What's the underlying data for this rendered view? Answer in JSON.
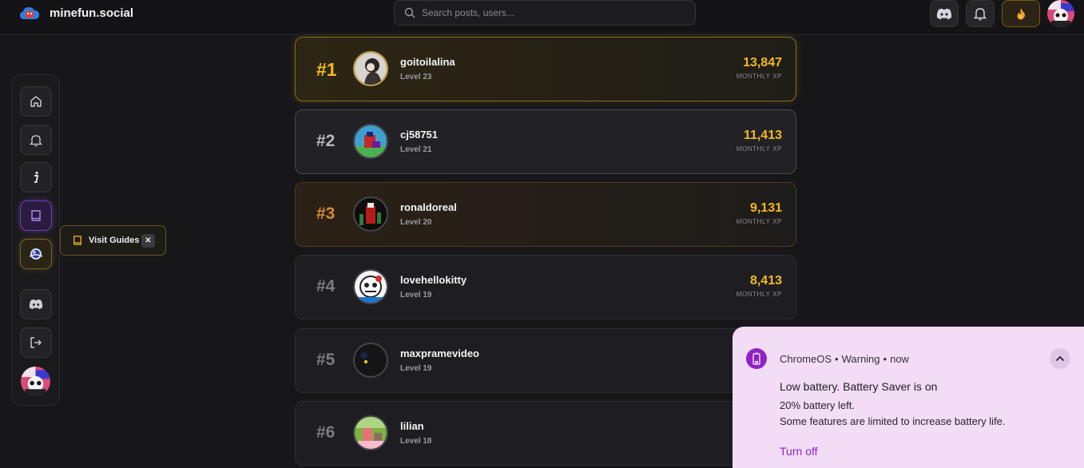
{
  "header": {
    "brand": "minefun.social",
    "search_placeholder": "Search posts, users..."
  },
  "tooltip": {
    "label": "Visit Guides",
    "close": "✕"
  },
  "leaderboard": [
    {
      "rank": "#1",
      "name": "goitoilalina",
      "level": "Level 23",
      "xp": "13,847",
      "xp_label": "MONTHLY XP"
    },
    {
      "rank": "#2",
      "name": "cj58751",
      "level": "Level 21",
      "xp": "11,413",
      "xp_label": "MONTHLY XP"
    },
    {
      "rank": "#3",
      "name": "ronaldoreal",
      "level": "Level 20",
      "xp": "9,131",
      "xp_label": "MONTHLY XP"
    },
    {
      "rank": "#4",
      "name": "lovehellokitty",
      "level": "Level 19",
      "xp": "8,413",
      "xp_label": "MONTHLY XP"
    },
    {
      "rank": "#5",
      "name": "maxpramevideo",
      "level": "Level 19",
      "xp": "",
      "xp_label": ""
    },
    {
      "rank": "#6",
      "name": "lilian",
      "level": "Level 18",
      "xp": "",
      "xp_label": ""
    }
  ],
  "notification": {
    "source": "ChromeOS",
    "severity": "Warning",
    "time": "now",
    "title": "Low battery. Battery Saver is on",
    "line1": "20% battery left.",
    "line2": "Some features are limited to increase battery life.",
    "action": "Turn off"
  },
  "colors": {
    "gold": "#f4b91c",
    "bronze": "#d98a2e",
    "purple_accent": "#8e24c4",
    "background": "#17171a"
  }
}
